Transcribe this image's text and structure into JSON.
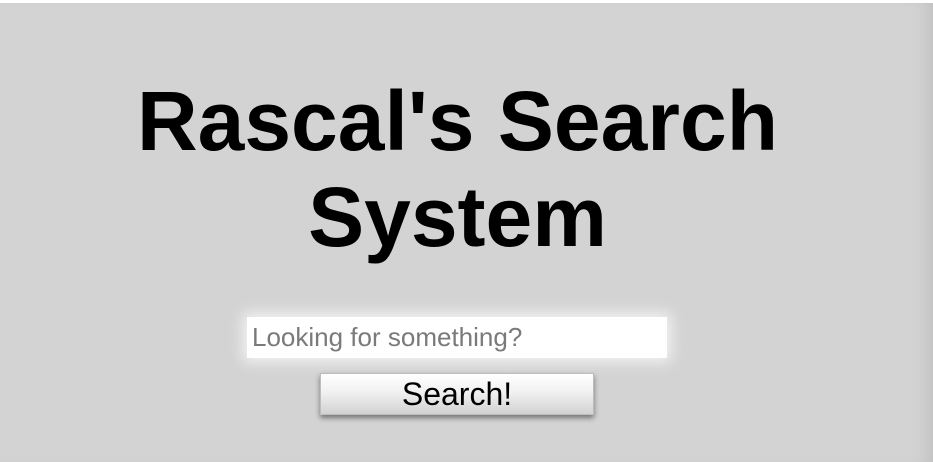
{
  "page": {
    "title": "Rascal's Search System",
    "background_color": "#d3d3d3"
  },
  "search": {
    "placeholder": "Looking for something?",
    "value": "",
    "button_label": "Search!"
  }
}
